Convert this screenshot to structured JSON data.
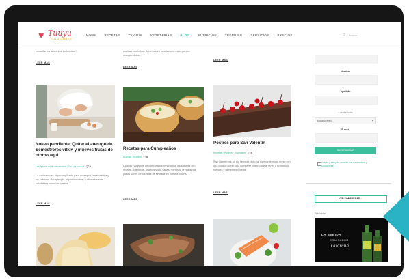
{
  "site": {
    "logo_text": "Tuuyu",
    "logo_sub": "SOLUCIONES"
  },
  "nav": {
    "items": [
      {
        "label": "HOME",
        "active": false
      },
      {
        "label": "RECETAS",
        "active": false
      },
      {
        "label": "TV GUÍA",
        "active": false
      },
      {
        "label": "VEGETARIAS",
        "active": false
      },
      {
        "label": "BLOG",
        "active": true
      },
      {
        "label": "NUTRICIÓN",
        "active": false
      },
      {
        "label": "TRENDING",
        "active": false
      },
      {
        "label": "SERVICIOS",
        "active": false
      },
      {
        "label": "PRECIOS",
        "active": false
      }
    ],
    "search_label": "Buscar"
  },
  "articles": {
    "row1_tails": [
      {
        "text": "consultar los alimentos en función…",
        "read_more": "LEER MÁS"
      },
      {
        "text": "cocinas con frutas. Sabemos en casos como esta, pueden recogiéndolos…",
        "read_more": "LEER MÁS"
      },
      {
        "text": "",
        "read_more": "LEER MÁS"
      }
    ],
    "row2": [
      {
        "title": "Nuevo pendiente, Quítar el atenzgo de Semestrores vítkiv y mueves frutas de otomo aqui.",
        "meta": "Las tips de un fin de semana ¡Guía de cocina!",
        "count": "0",
        "excerpt": "La cocina no es algo complicado para conseguir lo saludables y los sabores. Por ejemplo, algunas recetas y alimentos son saludables como los postres.",
        "read_more": "LEER MÁS"
      },
      {
        "title": "Recetas para Cumpleaños",
        "meta": "Cocina · Recetas",
        "count": "0",
        "excerpt": "Cuando hablamos de cumpleaños mezclamos los sabores con recetas auténticas, usamos y son sanas, mientras, preparamos platos sanos de los fines de semana en nuestra cocina.",
        "read_more": "LEER MÁS"
      },
      {
        "title": "Postres para San Valentín",
        "meta": "Recetas · Postres · Especiales",
        "count": "0",
        "excerpt": "San Valentín es un día lleno de dulzura, compartiendo la mesa con una ocasión ideal para compartir con tu pareja, tener o probar las mejores y diferentes recetas.",
        "read_more": "LEER MÁS"
      }
    ]
  },
  "sidebar": {
    "label_name": "Nombre",
    "label_email_field": "Apellido",
    "label_country": "Localización",
    "select_value": "Ecuador/Perú",
    "label_email": "E-mail",
    "submit_label": "SUSCRIBIRME",
    "terms_text": "Acepto y estoy de acuerdo con los términos y condiciones",
    "more_label": "VER SORPRESAS",
    "ad_label": "Publicidad",
    "ad_line1": "LA BEBIDA",
    "ad_line2": "CON SABOR",
    "ad_line3": "Guaraná"
  },
  "colors": {
    "accent": "#3bbf9c",
    "brand": "#e0445a"
  }
}
